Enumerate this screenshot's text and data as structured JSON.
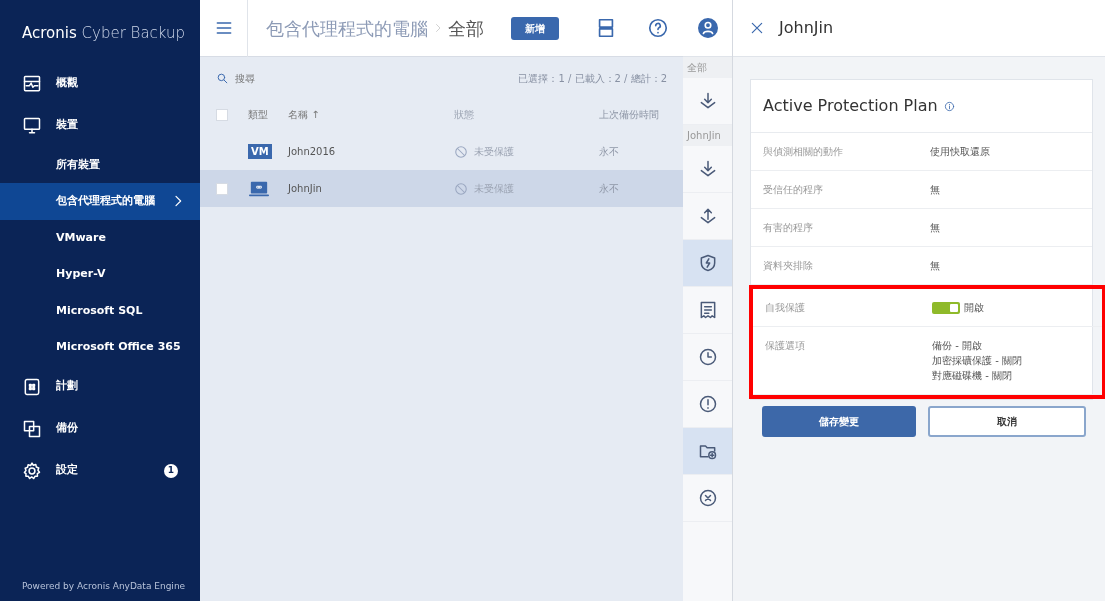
{
  "sidebar": {
    "logo": {
      "brand": "Acronis",
      "product": "Cyber Backup"
    },
    "items": [
      {
        "label": "概觀",
        "selected": false
      },
      {
        "label": "裝置",
        "selected": false,
        "children": [
          {
            "label": "所有裝置",
            "selected": false
          },
          {
            "label": "包含代理程式的電腦",
            "selected": true
          },
          {
            "label": "VMware",
            "selected": false
          },
          {
            "label": "Hyper-V",
            "selected": false
          },
          {
            "label": "Microsoft SQL",
            "selected": false
          },
          {
            "label": "Microsoft Office 365",
            "selected": false
          }
        ]
      },
      {
        "label": "計劃",
        "selected": false
      },
      {
        "label": "備份",
        "selected": false
      },
      {
        "label": "設定",
        "selected": false,
        "badge": "1"
      }
    ],
    "footer": "Powered by Acronis AnyData Engine"
  },
  "header": {
    "breadcrumb": [
      "包含代理程式的電腦",
      "全部"
    ],
    "add_button": "新增"
  },
  "toolbar": {
    "search_placeholder": "搜尋",
    "counter": "已選擇：1 / 已載入：2 / 總計：2"
  },
  "table": {
    "select_all_checked": false,
    "columns": [
      "類型",
      "名稱 ↑",
      "狀態",
      "上次備份時間"
    ],
    "rows": [
      {
        "type_label": "VM",
        "name": "John2016",
        "status": "未受保護",
        "last_backup": "永不",
        "selected": false
      },
      {
        "name": "JohnJin",
        "status": "未受保護",
        "last_backup": "永不",
        "selected": true,
        "checked": false
      }
    ]
  },
  "action_strip": [
    {
      "kind": "label",
      "text": "全部"
    },
    {
      "kind": "icon",
      "selected": false
    },
    {
      "kind": "label",
      "text": "JohnJin"
    },
    {
      "kind": "icon",
      "selected": false
    },
    {
      "kind": "icon",
      "selected": false
    },
    {
      "kind": "icon",
      "selected": true
    },
    {
      "kind": "icon",
      "selected": false
    },
    {
      "kind": "icon",
      "selected": false
    },
    {
      "kind": "icon",
      "selected": false
    },
    {
      "kind": "icon",
      "selected": true
    },
    {
      "kind": "icon",
      "selected": false
    }
  ],
  "panel": {
    "title": "JohnJin",
    "card_title": "Active Protection Plan",
    "rows": [
      {
        "label": "與偵測相關的動作",
        "kind": "text",
        "value": [
          "使用快取還原"
        ],
        "highlighted": false
      },
      {
        "label": "受信任的程序",
        "kind": "text",
        "value": [
          "無"
        ],
        "highlighted": false
      },
      {
        "label": "有害的程序",
        "kind": "text",
        "value": [
          "無"
        ],
        "highlighted": false
      },
      {
        "label": "資料夾排除",
        "kind": "text",
        "value": [
          "無"
        ],
        "highlighted": false
      },
      {
        "label": "自我保護",
        "kind": "toggle",
        "on": true,
        "value": [
          "開啟"
        ],
        "highlighted": true
      },
      {
        "label": "保護選項",
        "kind": "text",
        "value": [
          "備份 - 開啟",
          "加密採礦保護 - 關閉",
          "對應磁碟機 - 關閉"
        ],
        "highlighted": true
      }
    ],
    "buttons": [
      {
        "label": "儲存變更",
        "kind": "primary"
      },
      {
        "label": "取消",
        "kind": "secondary"
      }
    ]
  }
}
